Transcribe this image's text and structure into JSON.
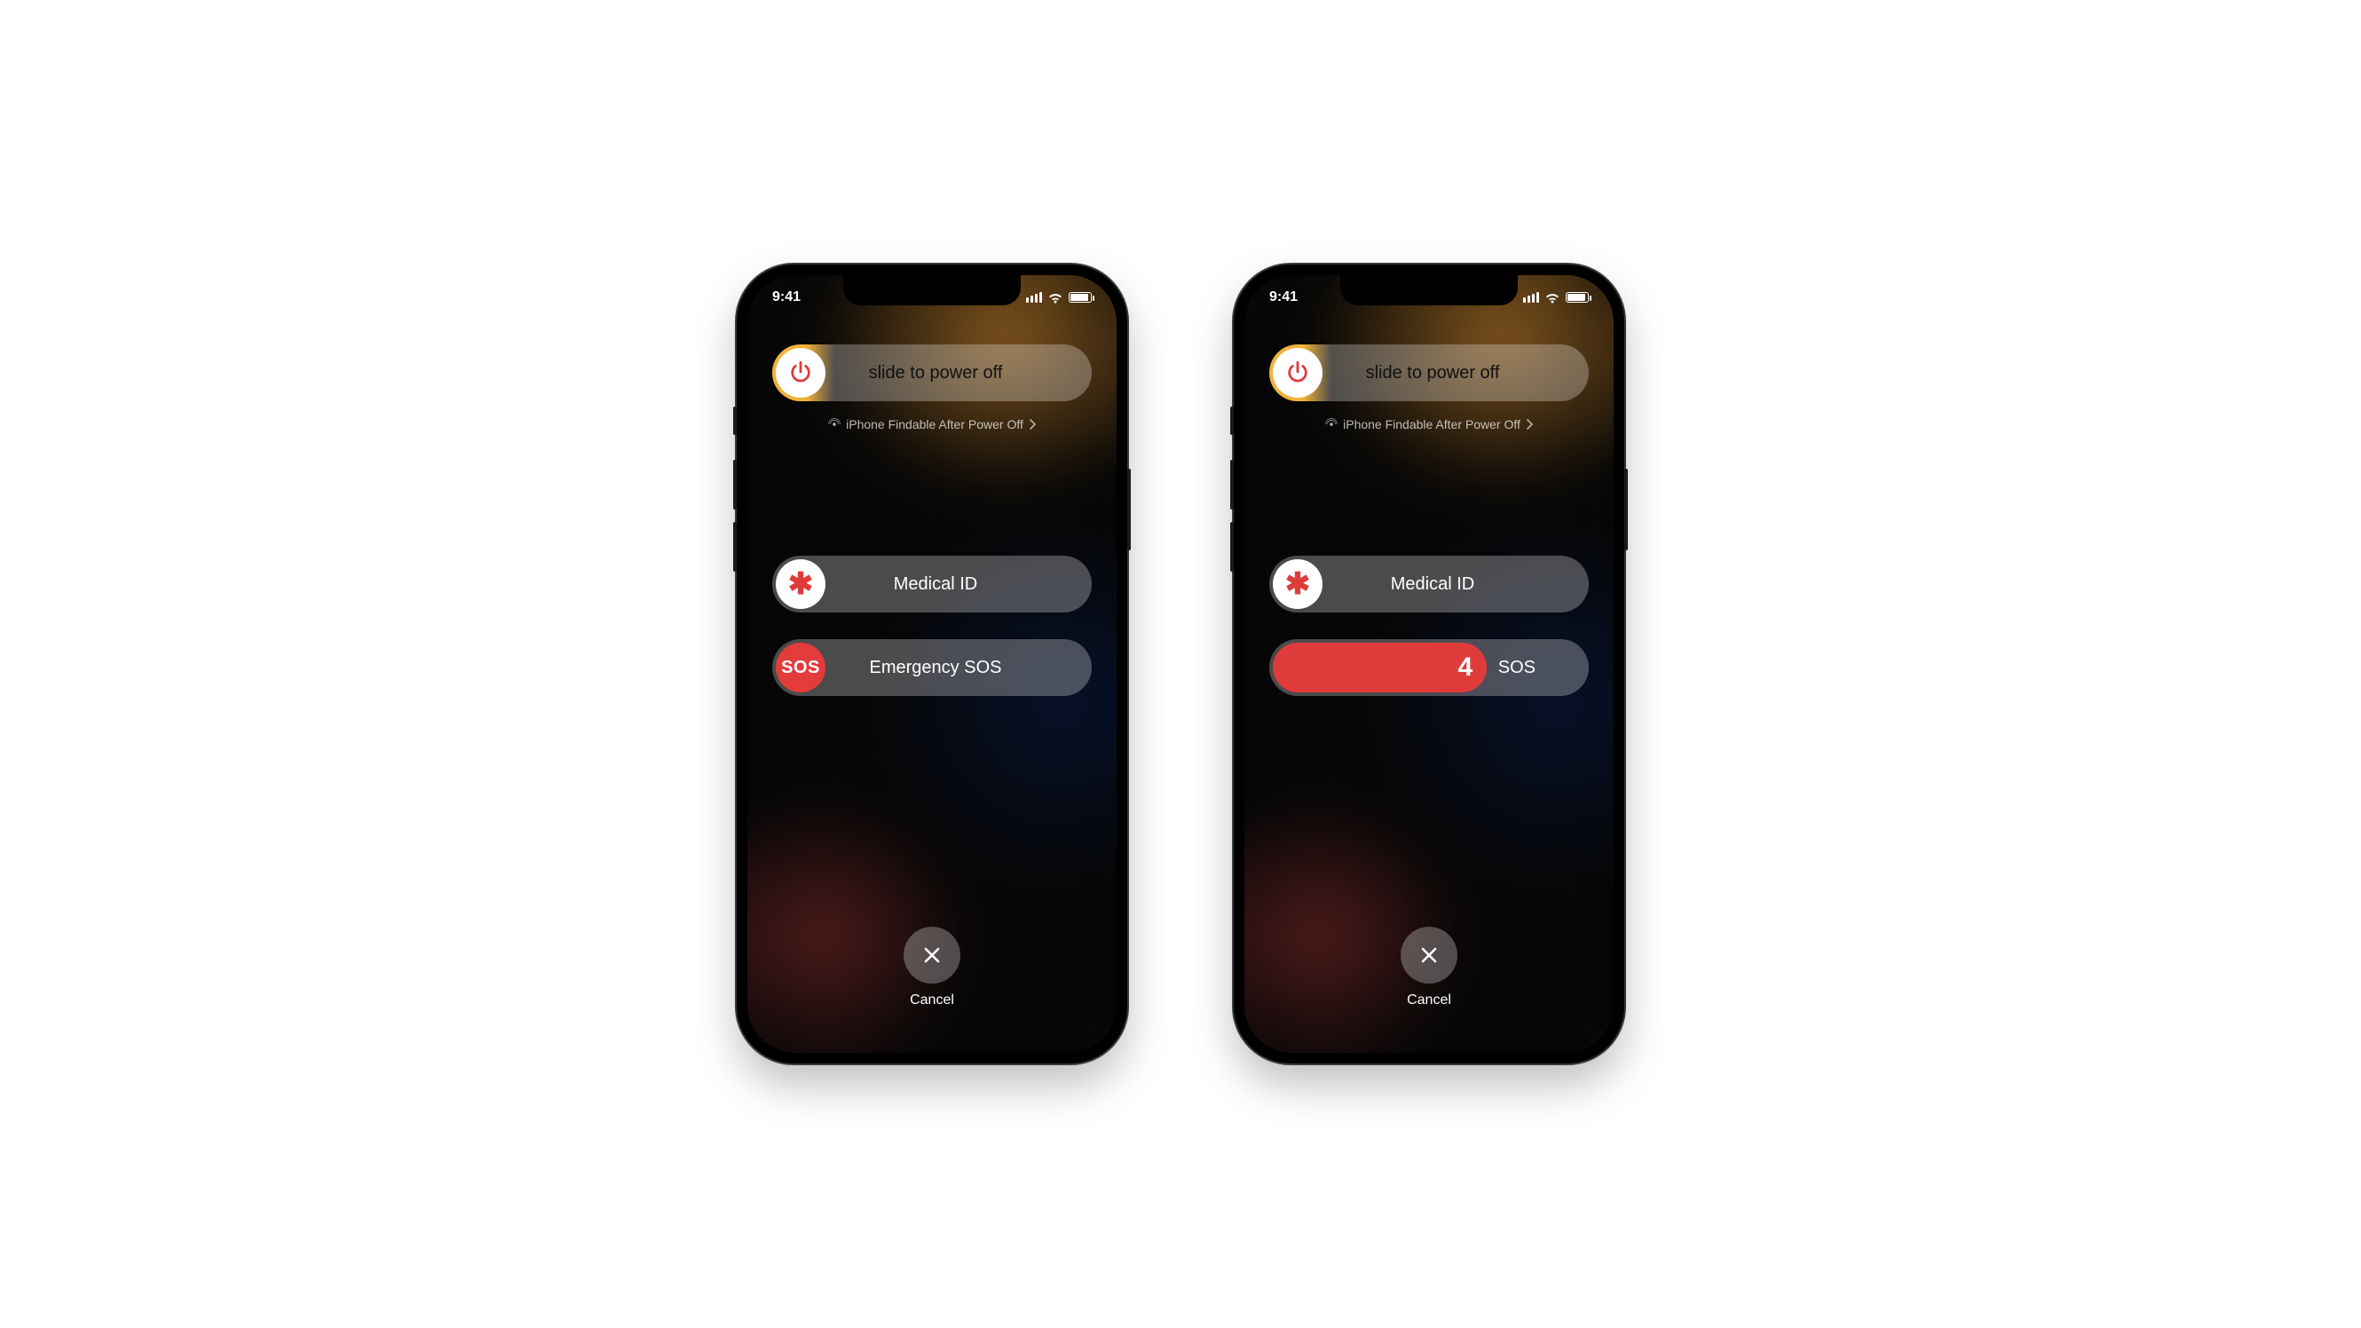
{
  "status_bar": {
    "time": "9:41"
  },
  "hint": "iPhone Findable After Power Off",
  "power_slider": {
    "label": "slide to power off",
    "icon": "power-icon"
  },
  "medical_slider": {
    "label": "Medical ID",
    "icon": "asterisk-icon"
  },
  "sos_slider": {
    "label": "Emergency SOS",
    "icon_text": "SOS"
  },
  "sos_countdown": {
    "value": "4",
    "trail": "SOS"
  },
  "cancel": {
    "label": "Cancel"
  }
}
